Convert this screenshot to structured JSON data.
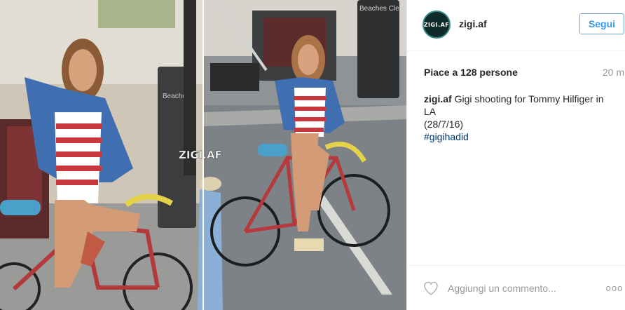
{
  "post": {
    "watermark": "ZIGI.AF",
    "photo_sign_1": "Beaches",
    "photo_sign_2": "Beaches Clean"
  },
  "header": {
    "avatar_text": "ZIGI.AF",
    "username": "zigi.af",
    "follow_label": "Segui"
  },
  "stats": {
    "likes": "Piace a 128 persone",
    "time": "20 m"
  },
  "caption": {
    "user": "zigi.af",
    "line1": "Gigi shooting for Tommy Hilfiger in LA",
    "line2": "(28/7/16)",
    "hashtag": "#gigihadid"
  },
  "footer": {
    "comment_placeholder": "Aggiungi un commento...",
    "more_label": "ooo"
  },
  "colors": {
    "accent": "#3897f0",
    "text": "#262626",
    "muted": "#999999",
    "hashtag": "#003569"
  },
  "icons": {
    "heart": "heart-icon",
    "more": "more-options-icon"
  }
}
